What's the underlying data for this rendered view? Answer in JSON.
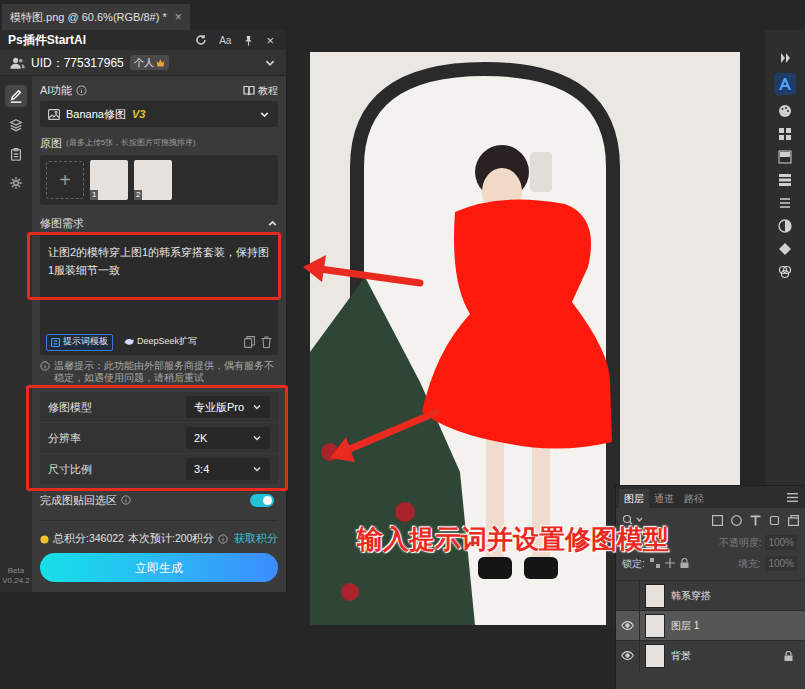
{
  "document_tab": {
    "title": "模特图.png @ 60.6%(RGB/8#) *",
    "close": "×"
  },
  "plugin": {
    "title": "Ps插件StartAI",
    "font_button": "Aa",
    "close": "×",
    "uid": "UID：775317965",
    "account_badge": "个人",
    "side_tabs": [
      {
        "kind": "pencil",
        "selected": true
      },
      {
        "kind": "layers",
        "selected": false
      },
      {
        "kind": "clipboard",
        "selected": false
      },
      {
        "kind": "gear",
        "selected": false
      }
    ],
    "version": [
      "Beta",
      "V0.24.2"
    ],
    "ai_label": "AI功能",
    "tutorial": "教程",
    "function_name": "Banana修图",
    "function_version": "V3",
    "source_label": "原图",
    "source_hint": "(最多上传5张，长按图片可拖拽排序)",
    "add_button": "+",
    "thumbnails": [
      {
        "number": "1"
      },
      {
        "number": "2"
      }
    ],
    "request_label": "修图需求",
    "prompt": "让图2的模特穿上图1的韩系穿搭套装，保持图1服装细节一致",
    "prompt_buttons": [
      {
        "label": "提示词模板",
        "kind": "template"
      },
      {
        "label": "DeepSeek扩写",
        "kind": "expand"
      }
    ],
    "notice": "温馨提示：此功能由外部服务商提供，偶有服务不稳定，如遇使用问题，请稍后重试",
    "settings": [
      {
        "label": "修图模型",
        "value": "专业版Pro"
      },
      {
        "label": "分辨率",
        "value": "2K"
      },
      {
        "label": "尺寸比例",
        "value": "3:4"
      }
    ],
    "paste_back": {
      "label": "完成图贴回选区",
      "on": true
    },
    "total_points": "总积分:346022",
    "estimate": "本次预计:200积分",
    "get_points": "获取积分",
    "generate": "立即生成"
  },
  "annotation": "输入提示词并设置修图模型",
  "layers_panel": {
    "tabs": [
      {
        "label": "图层",
        "selected": true
      },
      {
        "label": "通道",
        "selected": false
      },
      {
        "label": "路径",
        "selected": false
      }
    ],
    "opacity_label": "不透明度:",
    "opacity": "100%",
    "lock_label": "锁定:",
    "fill_label": "填充:",
    "fill": "100%",
    "layers": [
      {
        "name": "韩系穿搭",
        "visible": false,
        "selected": false,
        "locked": false
      },
      {
        "name": "图层 1",
        "visible": true,
        "selected": true,
        "locked": false
      },
      {
        "name": "背景",
        "visible": true,
        "selected": false,
        "locked": true
      }
    ]
  }
}
